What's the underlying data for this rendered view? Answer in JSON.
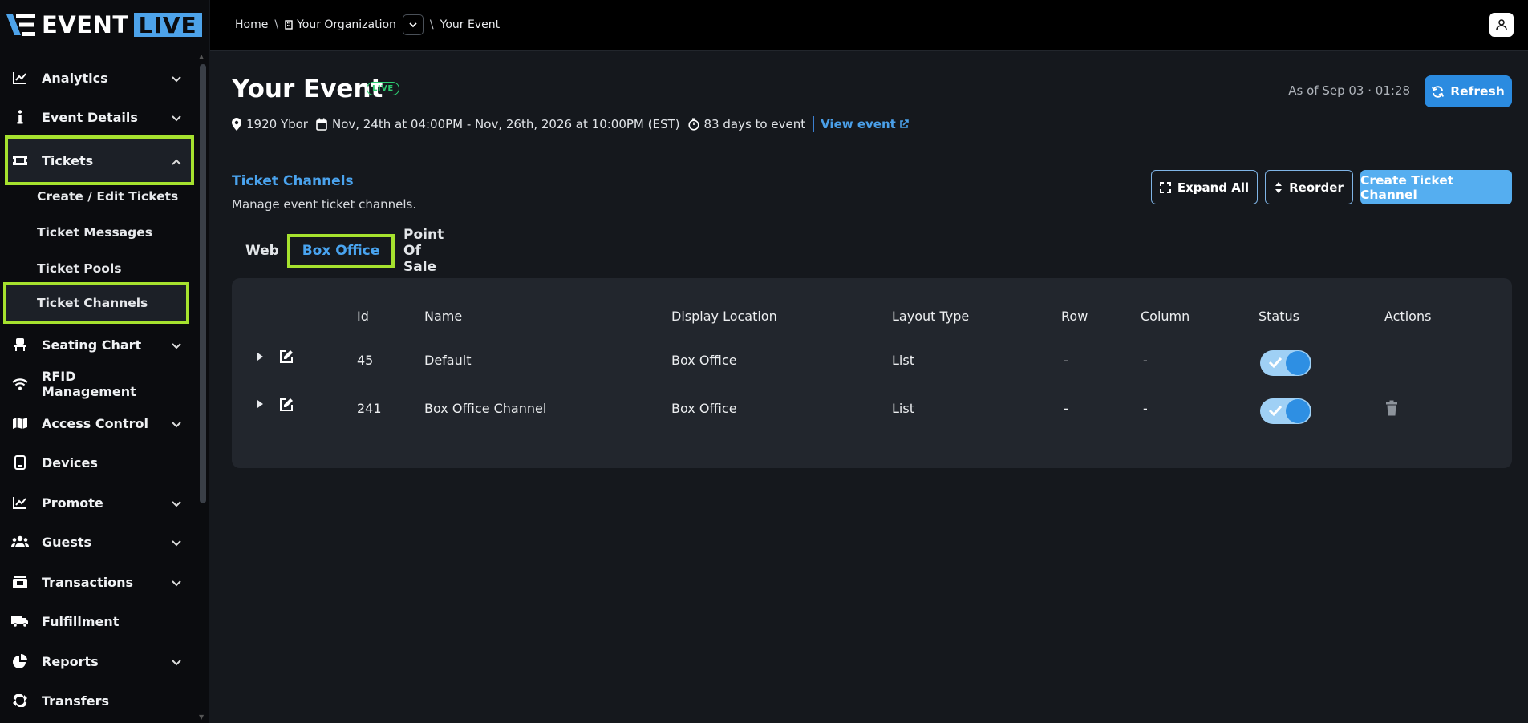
{
  "brand": {
    "event": "EVENT",
    "live": "LIVE"
  },
  "sidebar": {
    "items": [
      {
        "label": "Analytics",
        "icon": "chart-line-icon",
        "chevron": "down"
      },
      {
        "label": "Event Details",
        "icon": "info-icon",
        "chevron": "down"
      },
      {
        "label": "Tickets",
        "icon": "ticket-icon",
        "chevron": "up"
      },
      {
        "label": "Seating Chart",
        "icon": "seat-icon",
        "chevron": "down"
      },
      {
        "label": "RFID Management",
        "icon": "wifi-icon",
        "chevron": ""
      },
      {
        "label": "Access Control",
        "icon": "map-icon",
        "chevron": "down"
      },
      {
        "label": "Devices",
        "icon": "tablet-icon",
        "chevron": ""
      },
      {
        "label": "Promote",
        "icon": "chart-line-icon",
        "chevron": "down"
      },
      {
        "label": "Guests",
        "icon": "users-icon",
        "chevron": "down"
      },
      {
        "label": "Transactions",
        "icon": "register-icon",
        "chevron": "down"
      },
      {
        "label": "Fulfillment",
        "icon": "truck-icon",
        "chevron": ""
      },
      {
        "label": "Reports",
        "icon": "pie-chart-icon",
        "chevron": "down"
      },
      {
        "label": "Transfers",
        "icon": "transfer-icon",
        "chevron": ""
      }
    ],
    "ticket_subitems": [
      "Create / Edit Tickets",
      "Ticket Messages",
      "Ticket Pools",
      "Ticket Channels"
    ]
  },
  "breadcrumb": {
    "home": "Home",
    "org": "Your Organization",
    "event": "Your Event",
    "separator": "\\"
  },
  "event": {
    "title": "Your Event",
    "badge": "LIVE",
    "venue": "1920 Ybor",
    "dates": "Nov, 24th at 04:00PM - Nov, 26th, 2026 at 10:00PM (EST)",
    "countdown": "83 days to event",
    "view_link": "View event"
  },
  "header": {
    "as_of": "As of Sep 03 · 01:28",
    "refresh": "Refresh"
  },
  "section": {
    "title": "Ticket Channels",
    "subtitle": "Manage event ticket channels.",
    "expand_all": "Expand All",
    "reorder": "Reorder",
    "create": "Create Ticket Channel"
  },
  "tabs": [
    "Web",
    "Box Office",
    "Point Of Sale"
  ],
  "active_tab": "Box Office",
  "table": {
    "columns": [
      "Id",
      "Name",
      "Display Location",
      "Layout Type",
      "Row",
      "Column",
      "Status",
      "Actions"
    ],
    "rows": [
      {
        "id": "45",
        "name": "Default",
        "display_location": "Box Office",
        "layout_type": "List",
        "row": "-",
        "column": "-",
        "status": true,
        "deletable": false
      },
      {
        "id": "241",
        "name": "Box Office Channel",
        "display_location": "Box Office",
        "layout_type": "List",
        "row": "-",
        "column": "-",
        "status": true,
        "deletable": true
      }
    ]
  },
  "colors": {
    "accent": "#2b8be0",
    "highlight": "#a6e22e",
    "live": "#2ecc71",
    "link": "#4a9fe8"
  }
}
